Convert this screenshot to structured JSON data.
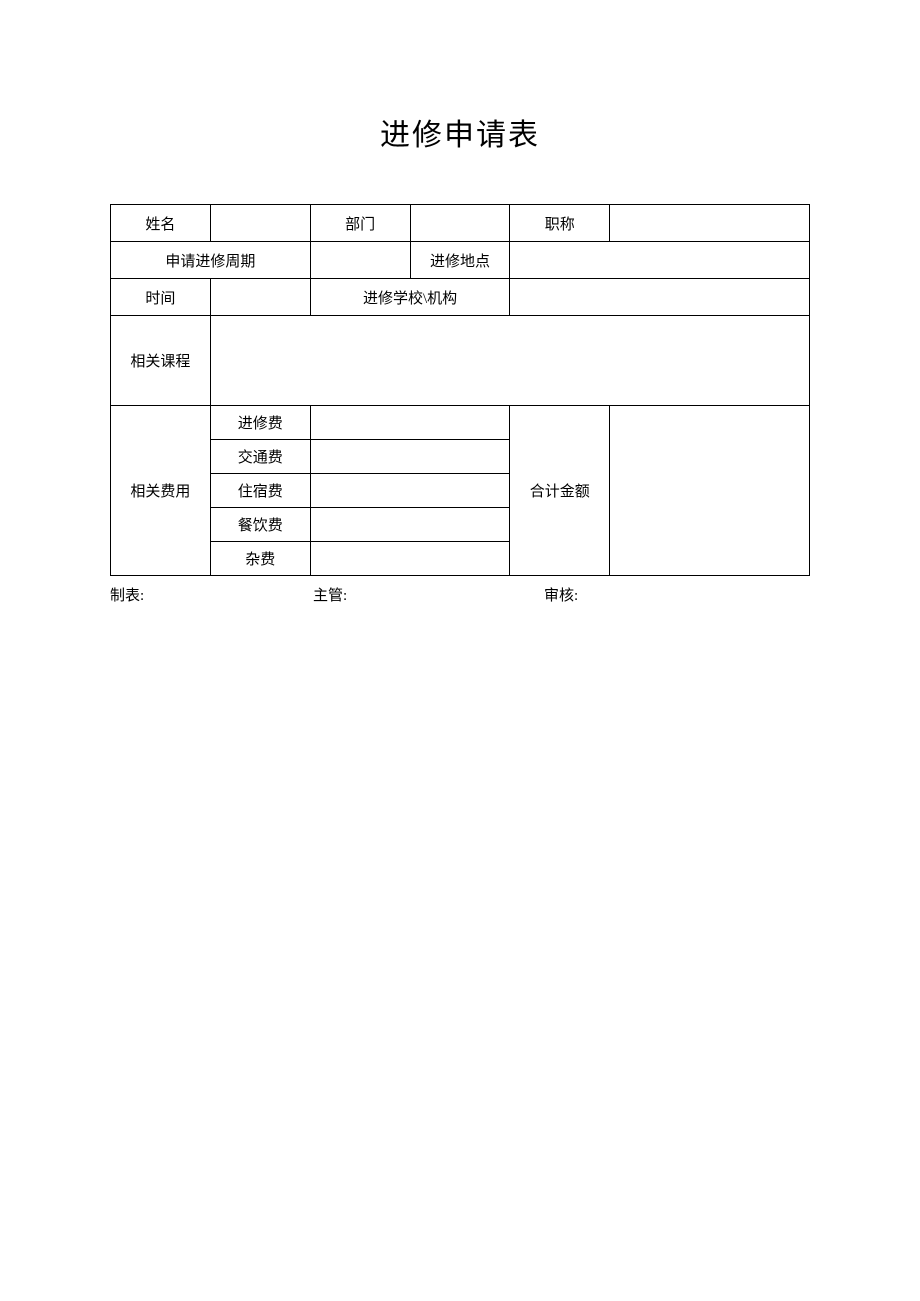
{
  "title": "进修申请表",
  "labels": {
    "name": "姓名",
    "department": "部门",
    "title_job": "职称",
    "apply_period": "申请进修周期",
    "location": "进修地点",
    "time": "时间",
    "school": "进修学校\\机构",
    "courses": "相关课程",
    "fees": "相关费用",
    "fee_training": "进修费",
    "fee_transport": "交通费",
    "fee_lodging": "住宿费",
    "fee_meal": "餐饮费",
    "fee_misc": "杂费",
    "total": "合计金额"
  },
  "values": {
    "name": "",
    "department": "",
    "title_job": "",
    "apply_period": "",
    "location": "",
    "time": "",
    "school": "",
    "courses": "",
    "fee_training": "",
    "fee_transport": "",
    "fee_lodging": "",
    "fee_meal": "",
    "fee_misc": "",
    "total": ""
  },
  "footer": {
    "preparer": "制表:",
    "supervisor": "主管:",
    "reviewer": "审核:"
  }
}
